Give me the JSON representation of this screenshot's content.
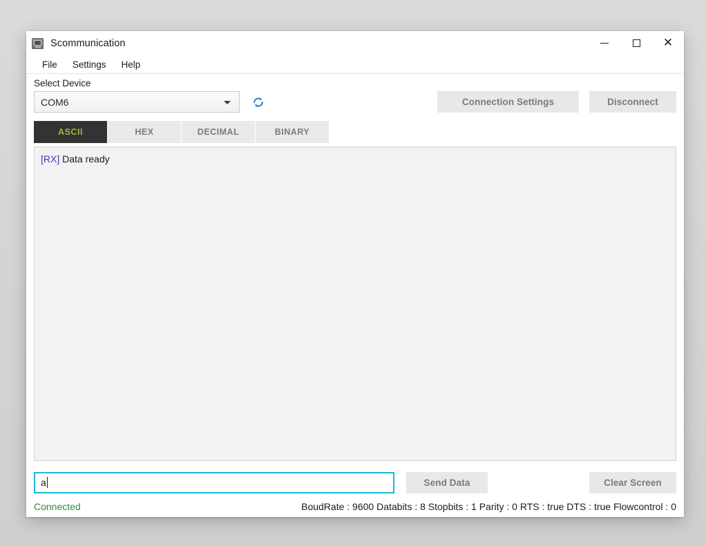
{
  "window": {
    "title": "Scommunication",
    "icon": "com-port-device-icon",
    "controls": {
      "minimize": "minimize-icon",
      "maximize": "maximize-icon",
      "close": "close-icon",
      "close_glyph": "✕"
    }
  },
  "menubar": {
    "items": [
      {
        "label": "File"
      },
      {
        "label": "Settings"
      },
      {
        "label": "Help"
      }
    ]
  },
  "device": {
    "label": "Select Device",
    "selected": "COM6",
    "options": [
      "COM6"
    ],
    "refresh_icon": "refresh-icon",
    "dropdown_icon": "chevron-down-icon"
  },
  "toolbar": {
    "connection_settings_label": "Connection Settings",
    "disconnect_label": "Disconnect"
  },
  "tabs": [
    {
      "label": "ASCII",
      "active": true
    },
    {
      "label": "HEX",
      "active": false
    },
    {
      "label": "DECIMAL",
      "active": false
    },
    {
      "label": "BINARY",
      "active": false
    }
  ],
  "log": {
    "lines": [
      {
        "tag": "[RX]",
        "message": " Data ready"
      }
    ]
  },
  "send": {
    "input_value": "a",
    "input_placeholder": "",
    "send_label": "Send Data",
    "clear_label": "Clear Screen"
  },
  "status": {
    "connection": "Connected",
    "params": "BoudRate : 9600 Databits : 8 Stopbits : 1 Parity : 0 RTS : true DTS : true Flowcontrol : 0"
  },
  "colors": {
    "accent_tab_active_bg": "#333333",
    "accent_tab_active_text": "#9fb63c",
    "focus_border": "#1ab5de",
    "connected_text": "#2f8a34",
    "rx_tag": "#3a3ad0",
    "refresh_icon": "#2a7fd4"
  }
}
